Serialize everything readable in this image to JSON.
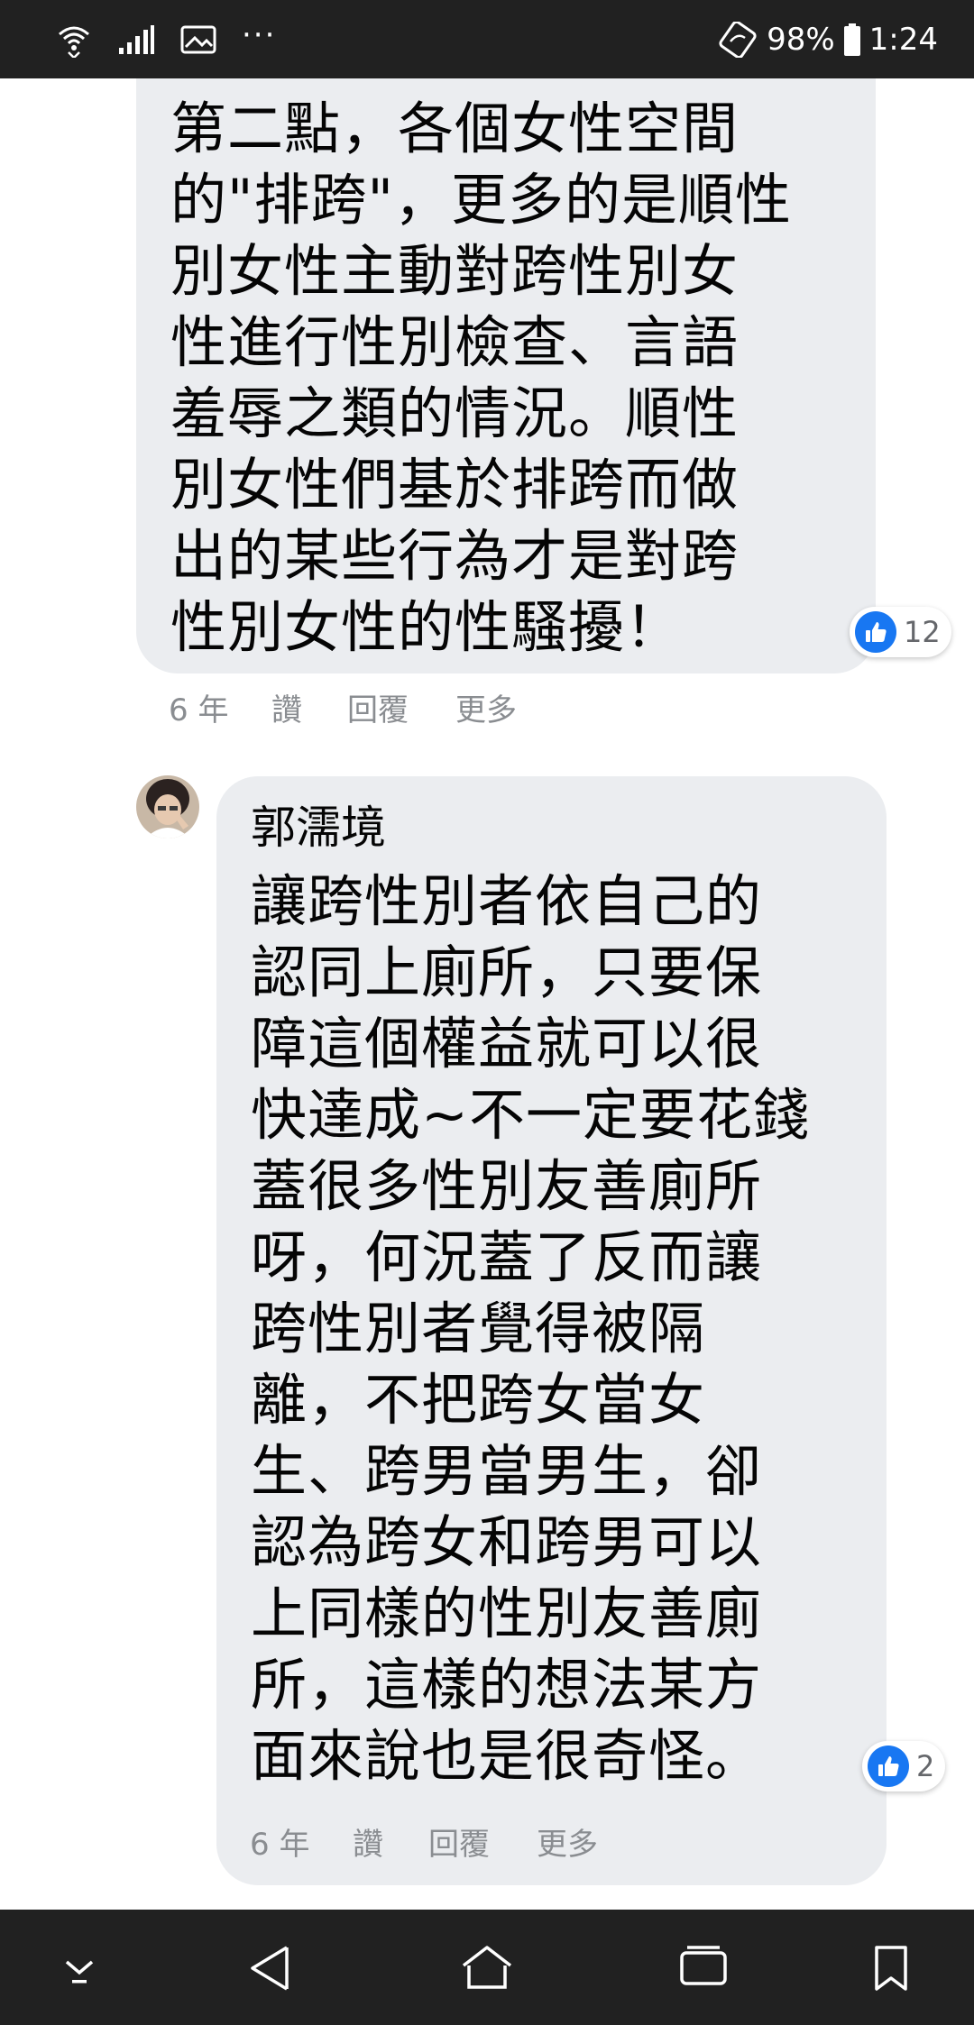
{
  "status_bar": {
    "left_icons": [
      "wifi-icon",
      "signal-icon",
      "image-icon",
      "more-dots-icon"
    ],
    "more_dots": "···",
    "battery_percent": "98%",
    "time": "1:24"
  },
  "comments": [
    {
      "text": "第二點，各個女性空間\n的\"排跨\"，更多的是順性\n別女性主動對跨性別女\n性進行性別檢查、言語\n羞辱之類的情況。順性\n別女性們基於排跨而做\n出的某些行為才是對跨\n性別女性的性騷擾！",
      "reactions": {
        "icon": "like-icon",
        "count": "12"
      },
      "actions": {
        "time": "6 年",
        "like": "讚",
        "reply": "回覆",
        "more": "更多"
      }
    },
    {
      "author": "郭濡境",
      "avatar_icon": "user-avatar",
      "text": "讓跨性別者依自己的\n認同上廁所，只要保\n障這個權益就可以很\n快達成~不一定要花錢\n蓋很多性別友善廁所\n呀，何況蓋了反而讓\n跨性別者覺得被隔\n離，不把跨女當女\n生、跨男當男生，卻\n認為跨女和跨男可以\n上同樣的性別友善廁\n所，這樣的想法某方\n面來說也是很奇怪。",
      "reactions": {
        "icon": "like-icon",
        "count": "2"
      },
      "actions": {
        "time": "6 年",
        "like": "讚",
        "reply": "回覆",
        "more": "更多"
      }
    }
  ],
  "nav_bar": {
    "buttons": [
      "collapse-icon",
      "back-icon",
      "home-icon",
      "recents-icon",
      "bookmark-icon"
    ]
  },
  "colors": {
    "bubble": "#ebedf0",
    "like_blue": "#1877f2",
    "meta_text": "#8a8d91",
    "bar_background": "#212121"
  }
}
